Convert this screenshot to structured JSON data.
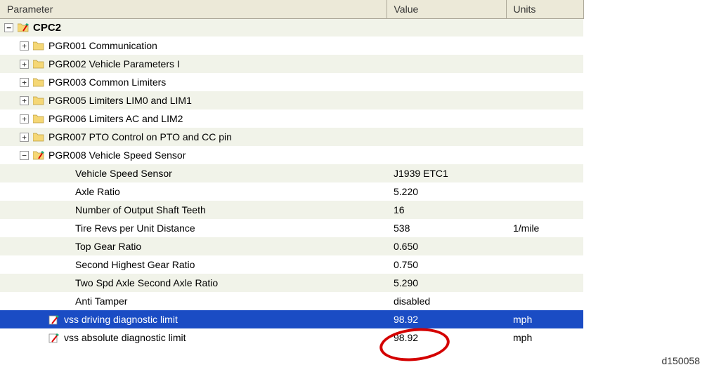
{
  "header": {
    "parameter": "Parameter",
    "value": "Value",
    "units": "Units"
  },
  "root": {
    "label": "CPC2"
  },
  "groups": [
    {
      "label": "PGR001 Communication",
      "expanded": false
    },
    {
      "label": "PGR002 Vehicle Parameters I",
      "expanded": false
    },
    {
      "label": "PGR003 Common Limiters",
      "expanded": false
    },
    {
      "label": "PGR005 Limiters LIM0 and LIM1",
      "expanded": false
    },
    {
      "label": "PGR006 Limiters AC and LIM2",
      "expanded": false
    },
    {
      "label": "PGR007 PTO Control on PTO and CC pin",
      "expanded": false
    },
    {
      "label": "PGR008 Vehicle Speed Sensor",
      "expanded": true
    }
  ],
  "params": [
    {
      "label": "Vehicle Speed Sensor",
      "value": "J1939 ETC1",
      "units": "",
      "editable": false,
      "selected": false
    },
    {
      "label": "Axle Ratio",
      "value": "5.220",
      "units": "",
      "editable": false,
      "selected": false
    },
    {
      "label": "Number of Output Shaft Teeth",
      "value": "16",
      "units": "",
      "editable": false,
      "selected": false
    },
    {
      "label": "Tire Revs per Unit Distance",
      "value": "538",
      "units": "1/mile",
      "editable": false,
      "selected": false
    },
    {
      "label": "Top Gear Ratio",
      "value": "0.650",
      "units": "",
      "editable": false,
      "selected": false
    },
    {
      "label": "Second Highest Gear Ratio",
      "value": "0.750",
      "units": "",
      "editable": false,
      "selected": false
    },
    {
      "label": "Two Spd Axle Second Axle Ratio",
      "value": "5.290",
      "units": "",
      "editable": false,
      "selected": false
    },
    {
      "label": "Anti Tamper",
      "value": "disabled",
      "units": "",
      "editable": false,
      "selected": false
    },
    {
      "label": "vss driving diagnostic limit",
      "value": "98.92",
      "units": "mph",
      "editable": true,
      "selected": true
    },
    {
      "label": "vss absolute diagnostic limit",
      "value": "98.92",
      "units": "mph",
      "editable": true,
      "selected": false
    }
  ],
  "docId": "d150058"
}
